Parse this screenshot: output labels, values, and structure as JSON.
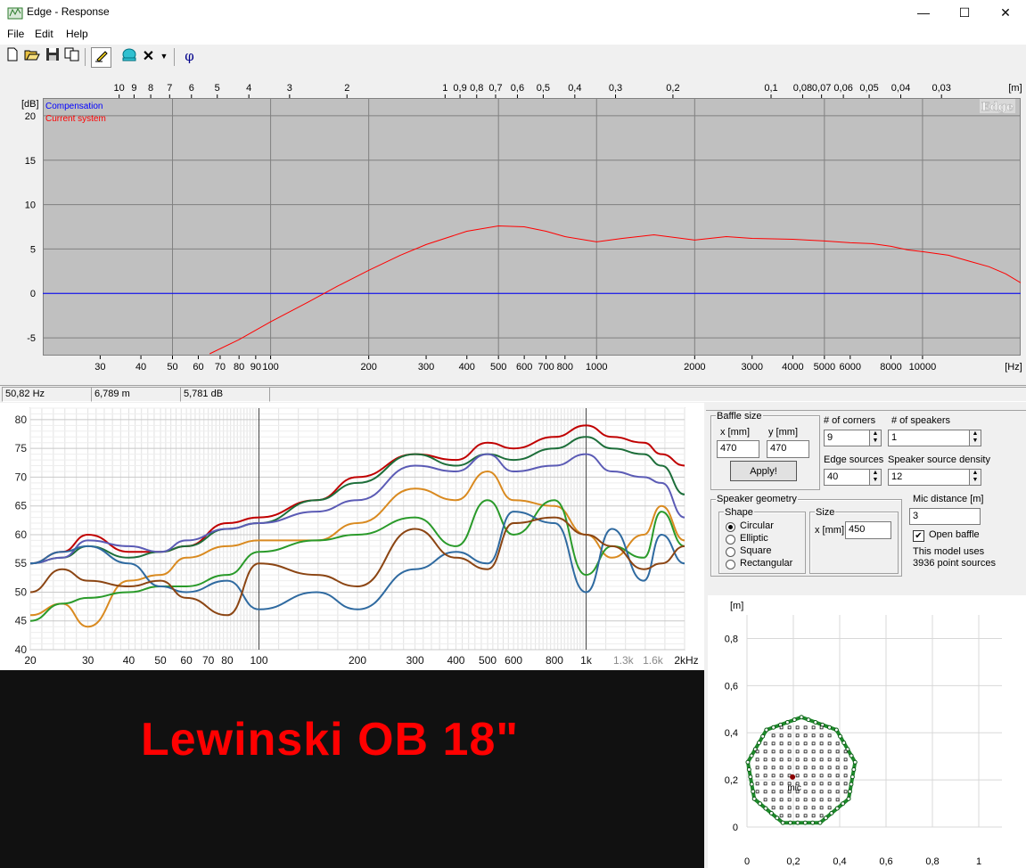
{
  "window": {
    "title": "Edge - Response",
    "minimize": "—",
    "maximize": "☐",
    "close": "✕"
  },
  "menu": {
    "file": "File",
    "edit": "Edit",
    "help": "Help"
  },
  "toolbar": {
    "icons": [
      "new-icon",
      "open-icon",
      "save-icon",
      "copy-icon",
      "pencil-icon",
      "speaker-icon",
      "delete-icon",
      "dropdown-icon",
      "phase-icon"
    ],
    "phase_label": "φ"
  },
  "top_chart": {
    "distance_axis_unit": "[m]",
    "distance_ticks": [
      "10",
      "9",
      "8",
      "7",
      "6",
      "5",
      "4",
      "3",
      "2",
      "1",
      "0,9",
      "0,8",
      "0,7",
      "0,6",
      "0,5",
      "0,4",
      "0,3",
      "0,2",
      "0,1",
      "0,08",
      "0,07",
      "0,06",
      "0,05",
      "0,04",
      "0,03"
    ],
    "y_unit": "[dB]",
    "y_ticks": [
      "20",
      "15",
      "10",
      "5",
      "0",
      "-5"
    ],
    "x_unit": "[Hz]",
    "x_ticks": [
      "30",
      "40",
      "50",
      "60",
      "70",
      "80",
      "90",
      "100",
      "200",
      "300",
      "400",
      "500",
      "600",
      "700",
      "800",
      "1000",
      "2000",
      "3000",
      "4000",
      "5000",
      "6000",
      "8000",
      "10000"
    ],
    "legend": [
      {
        "name": "Compensation",
        "color": "#0000ff"
      },
      {
        "name": "Current system",
        "color": "#ff0000"
      }
    ],
    "watermark": "Edge"
  },
  "chart_data": [
    {
      "type": "line",
      "xscale": "log",
      "xlim": [
        20,
        20000
      ],
      "ylim": [
        -7,
        22
      ],
      "xlabel": "[Hz]",
      "ylabel": "[dB]",
      "series": [
        {
          "name": "Compensation",
          "color": "#0000ff",
          "x": [
            20,
            20000
          ],
          "y": [
            0,
            0
          ]
        },
        {
          "name": "Current system",
          "color": "#ff0000",
          "x": [
            65,
            80,
            100,
            130,
            160,
            200,
            250,
            300,
            400,
            500,
            600,
            700,
            800,
            1000,
            1200,
            1500,
            2000,
            2500,
            3000,
            4000,
            5000,
            6000,
            7000,
            8000,
            9000,
            10000,
            12000,
            14000,
            16000,
            18000,
            20000
          ],
          "y": [
            -6.8,
            -5.2,
            -3.2,
            -1.0,
            0.8,
            2.6,
            4.3,
            5.5,
            7.0,
            7.6,
            7.5,
            7.0,
            6.4,
            5.8,
            6.2,
            6.6,
            6.0,
            6.4,
            6.2,
            6.1,
            5.9,
            5.7,
            5.6,
            5.3,
            4.9,
            4.7,
            4.3,
            3.6,
            3.0,
            2.2,
            1.2
          ]
        }
      ]
    },
    {
      "type": "line",
      "xscale": "log",
      "xlim": [
        20,
        2000
      ],
      "ylim": [
        40,
        82
      ],
      "x_ticks": [
        "20",
        "30",
        "40",
        "50",
        "60",
        "70",
        "80",
        "100",
        "200",
        "300",
        "400",
        "500",
        "600",
        "800",
        "1k",
        "1.3k",
        "1.6k",
        "2kHz"
      ],
      "y_ticks": [
        "80",
        "75",
        "70",
        "65",
        "60",
        "55",
        "50",
        "45",
        "40"
      ],
      "series": [
        {
          "color": "#c00000",
          "x": [
            20,
            25,
            30,
            40,
            50,
            60,
            80,
            100,
            150,
            200,
            300,
            400,
            500,
            600,
            800,
            1000,
            1200,
            1500,
            1700,
            2000
          ],
          "y": [
            55,
            57,
            60,
            57,
            57,
            58,
            62,
            63,
            66,
            70,
            74,
            73,
            76,
            75,
            77,
            79,
            77,
            76,
            74,
            72
          ]
        },
        {
          "color": "#1d6e3a",
          "x": [
            20,
            25,
            30,
            40,
            50,
            60,
            80,
            100,
            150,
            200,
            300,
            400,
            500,
            600,
            800,
            1000,
            1200,
            1500,
            1700,
            2000
          ],
          "y": [
            55,
            56,
            58,
            56,
            57,
            58,
            61,
            62,
            66,
            69,
            74,
            72,
            74,
            73,
            75,
            77,
            75,
            74,
            72,
            67
          ]
        },
        {
          "color": "#5b5bb5",
          "x": [
            20,
            25,
            30,
            40,
            50,
            60,
            80,
            100,
            150,
            200,
            300,
            400,
            500,
            600,
            800,
            1000,
            1200,
            1500,
            1700,
            2000
          ],
          "y": [
            55,
            56,
            59,
            58,
            57,
            59,
            61,
            62,
            64,
            66,
            72,
            71,
            74,
            71,
            72,
            74,
            71,
            70,
            69,
            63
          ]
        },
        {
          "color": "#d98a20",
          "x": [
            20,
            25,
            30,
            40,
            50,
            60,
            80,
            100,
            150,
            200,
            300,
            400,
            500,
            600,
            800,
            1000,
            1200,
            1500,
            1700,
            2000
          ],
          "y": [
            46,
            48,
            44,
            52,
            53,
            56,
            58,
            59,
            59,
            62,
            68,
            66,
            71,
            66,
            65,
            60,
            56,
            60,
            65,
            59
          ]
        },
        {
          "color": "#2a9a2a",
          "x": [
            20,
            25,
            30,
            40,
            50,
            60,
            80,
            100,
            150,
            200,
            300,
            400,
            500,
            600,
            800,
            1000,
            1200,
            1500,
            1700,
            2000
          ],
          "y": [
            45,
            48,
            49,
            50,
            51,
            51,
            53,
            57,
            59,
            60,
            63,
            58,
            66,
            60,
            66,
            53,
            58,
            56,
            64,
            58
          ]
        },
        {
          "color": "#2f6aa0",
          "x": [
            20,
            25,
            30,
            40,
            50,
            60,
            80,
            100,
            150,
            200,
            300,
            400,
            500,
            600,
            800,
            1000,
            1200,
            1500,
            1700,
            2000
          ],
          "y": [
            55,
            57,
            58,
            55,
            51,
            50,
            52,
            47,
            50,
            47,
            54,
            57,
            55,
            64,
            62,
            50,
            61,
            52,
            60,
            55
          ]
        },
        {
          "color": "#8b4513",
          "x": [
            20,
            25,
            30,
            40,
            50,
            60,
            80,
            100,
            150,
            200,
            300,
            400,
            500,
            600,
            800,
            1000,
            1200,
            1500,
            1700,
            2000
          ],
          "y": [
            50,
            54,
            52,
            51,
            52,
            49,
            46,
            55,
            53,
            51,
            61,
            56,
            54,
            62,
            63,
            60,
            58,
            54,
            55,
            58
          ]
        }
      ]
    }
  ],
  "status": {
    "freq": "50,82 Hz",
    "dist": "6,789 m",
    "level": "5,781 dB"
  },
  "banner": {
    "text": "Lewinski OB 18\""
  },
  "panel": {
    "baffle_size_label": "Baffle size",
    "x_label": "x [mm]",
    "x_value": "470",
    "y_label": "y [mm]",
    "y_value": "470",
    "apply_label": "Apply!",
    "corners_label": "# of corners",
    "corners_value": "9",
    "speakers_label": "# of speakers",
    "speakers_value": "1",
    "edge_sources_label": "Edge sources",
    "edge_sources_value": "40",
    "density_label": "Speaker source density",
    "density_value": "12",
    "speaker_geometry_label": "Speaker geometry",
    "shape_label": "Shape",
    "shapes": [
      "Circular",
      "Elliptic",
      "Square",
      "Rectangular"
    ],
    "size_label": "Size",
    "size_x_label": "x [mm]",
    "size_x_value": "450",
    "mic_distance_label": "Mic distance [m]",
    "mic_distance_value": "3",
    "open_baffle_label": "Open baffle",
    "model_info_1": "This model uses",
    "model_info_2": "3936 point sources"
  },
  "baffle_plot": {
    "unit": "[m]",
    "y_ticks": [
      "0,8",
      "0,6",
      "0,4",
      "0,2",
      "0"
    ],
    "x_ticks": [
      "0",
      "0,2",
      "0,4",
      "0,6",
      "0,8",
      "1"
    ],
    "mic_label": "mic"
  }
}
